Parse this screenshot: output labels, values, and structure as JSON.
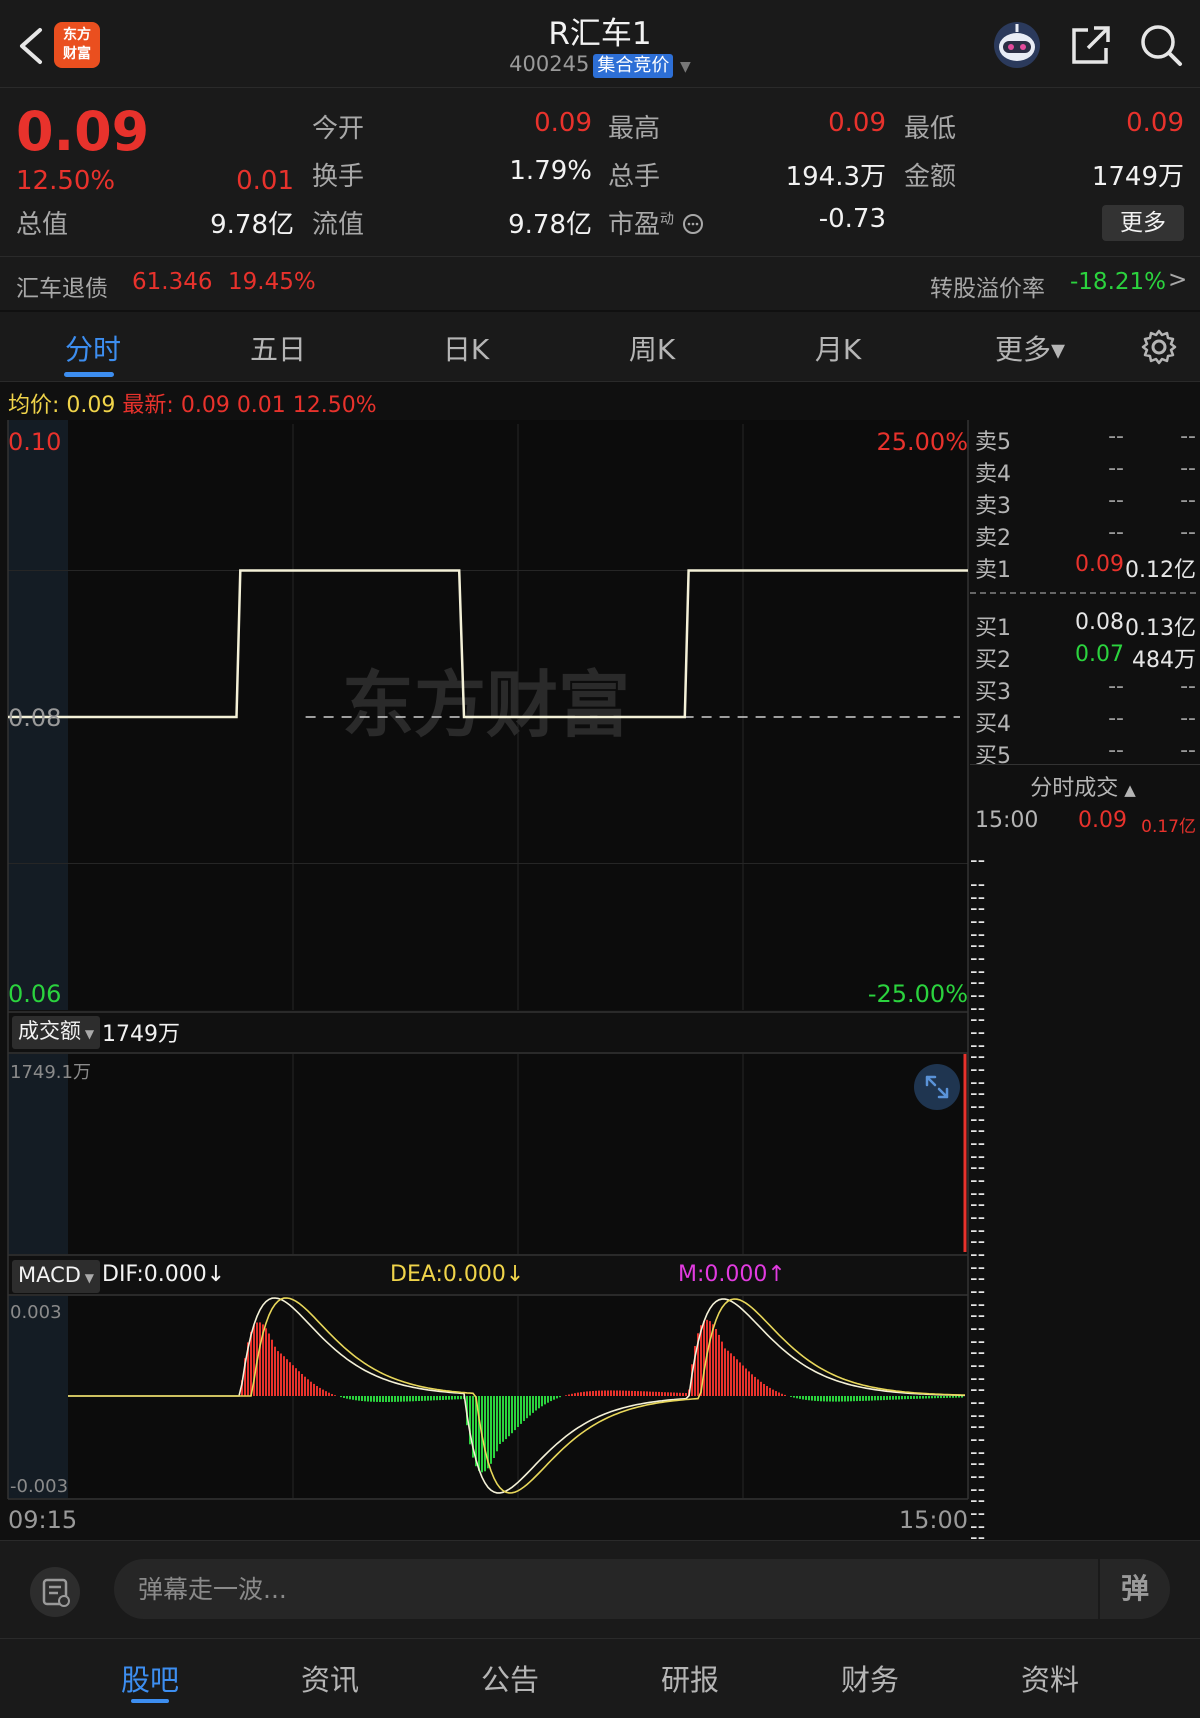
{
  "header": {
    "logo_text": "东方\n财富",
    "title": "R汇车1",
    "code": "400245",
    "badge": "集合竞价",
    "dropdown_glyph": "▼"
  },
  "quote": {
    "price": "0.09",
    "change_pct": "12.50%",
    "change_abs": "0.01",
    "fields": {
      "open_label": "今开",
      "open": "0.09",
      "high_label": "最高",
      "high": "0.09",
      "low_label": "最低",
      "low": "0.09",
      "turnover_label": "换手",
      "turnover": "1.79%",
      "volume_label": "总手",
      "volume": "194.3万",
      "amount_label": "金额",
      "amount": "1749万",
      "mktcap_label": "总值",
      "mktcap": "9.78亿",
      "float_label": "流值",
      "float": "9.78亿",
      "pe_label": "市盈",
      "pe_sup": "动",
      "pe": "-0.73"
    },
    "more_label": "更多",
    "bond": {
      "name": "汇车退债",
      "price": "61.346",
      "pct": "19.45%",
      "premium_label": "转股溢价率",
      "premium": "-18.21%",
      "arrow": ">"
    }
  },
  "tabs": [
    {
      "label": "分时",
      "active": true
    },
    {
      "label": "五日"
    },
    {
      "label": "日K"
    },
    {
      "label": "周K"
    },
    {
      "label": "月K"
    },
    {
      "label": "更多▾"
    }
  ],
  "info_strip": {
    "avg_label": "均价:",
    "avg": "0.09",
    "latest_label": "最新:",
    "latest": "0.09",
    "chg": "0.01",
    "pct": "12.50%"
  },
  "chart_data": {
    "type": "line",
    "price_axis": {
      "top": "0.10",
      "mid": "0.08",
      "bottom": "0.06"
    },
    "pct_axis": {
      "top": "25.00%",
      "bottom": "-25.00%"
    },
    "ylim": [
      0.06,
      0.1
    ],
    "prev_close": 0.08,
    "series": [
      {
        "values": [
          {
            "t": 0.0,
            "v": 0.08
          },
          {
            "t": 0.238,
            "v": 0.08
          },
          {
            "t": 0.242,
            "v": 0.09
          },
          {
            "t": 0.47,
            "v": 0.09
          },
          {
            "t": 0.475,
            "v": 0.08
          },
          {
            "t": 0.705,
            "v": 0.08
          },
          {
            "t": 0.709,
            "v": 0.09
          },
          {
            "t": 1.0,
            "v": 0.09
          }
        ]
      }
    ],
    "watermark": "东方财富",
    "volume_panel": {
      "selector": "成交额",
      "value": "1749万",
      "axis_top": "1749.1万"
    },
    "macd_panel": {
      "selector": "MACD",
      "dif": "DIF:0.000↓",
      "dea": "DEA:0.000↓",
      "m": "M:0.000↑",
      "axis_top": "0.003",
      "axis_bottom": "-0.003"
    },
    "time_axis": {
      "start": "09:15",
      "end": "15:00"
    }
  },
  "order_book": {
    "asks": [
      {
        "label": "卖5",
        "price": "--",
        "vol": "--"
      },
      {
        "label": "卖4",
        "price": "--",
        "vol": "--"
      },
      {
        "label": "卖3",
        "price": "--",
        "vol": "--"
      },
      {
        "label": "卖2",
        "price": "--",
        "vol": "--"
      },
      {
        "label": "卖1",
        "price": "0.09",
        "vol": "0.12亿"
      }
    ],
    "bids": [
      {
        "label": "买1",
        "price": "0.08",
        "vol": "0.13亿"
      },
      {
        "label": "买2",
        "price": "0.07",
        "vol": "484万"
      },
      {
        "label": "买3",
        "price": "--",
        "vol": "--"
      },
      {
        "label": "买4",
        "price": "--",
        "vol": "--"
      },
      {
        "label": "买5",
        "price": "--",
        "vol": "--"
      }
    ],
    "ticks_title": "分时成交",
    "first_tick": {
      "time": "15:00",
      "price": "0.09",
      "vol": "0.17亿"
    },
    "empty": "--"
  },
  "comment": {
    "placeholder": "弹幕走一波...",
    "danmu": "弹"
  },
  "bottom_nav": [
    {
      "label": "股吧",
      "active": true
    },
    {
      "label": "资讯"
    },
    {
      "label": "公告"
    },
    {
      "label": "研报"
    },
    {
      "label": "财务"
    },
    {
      "label": "资料"
    }
  ]
}
